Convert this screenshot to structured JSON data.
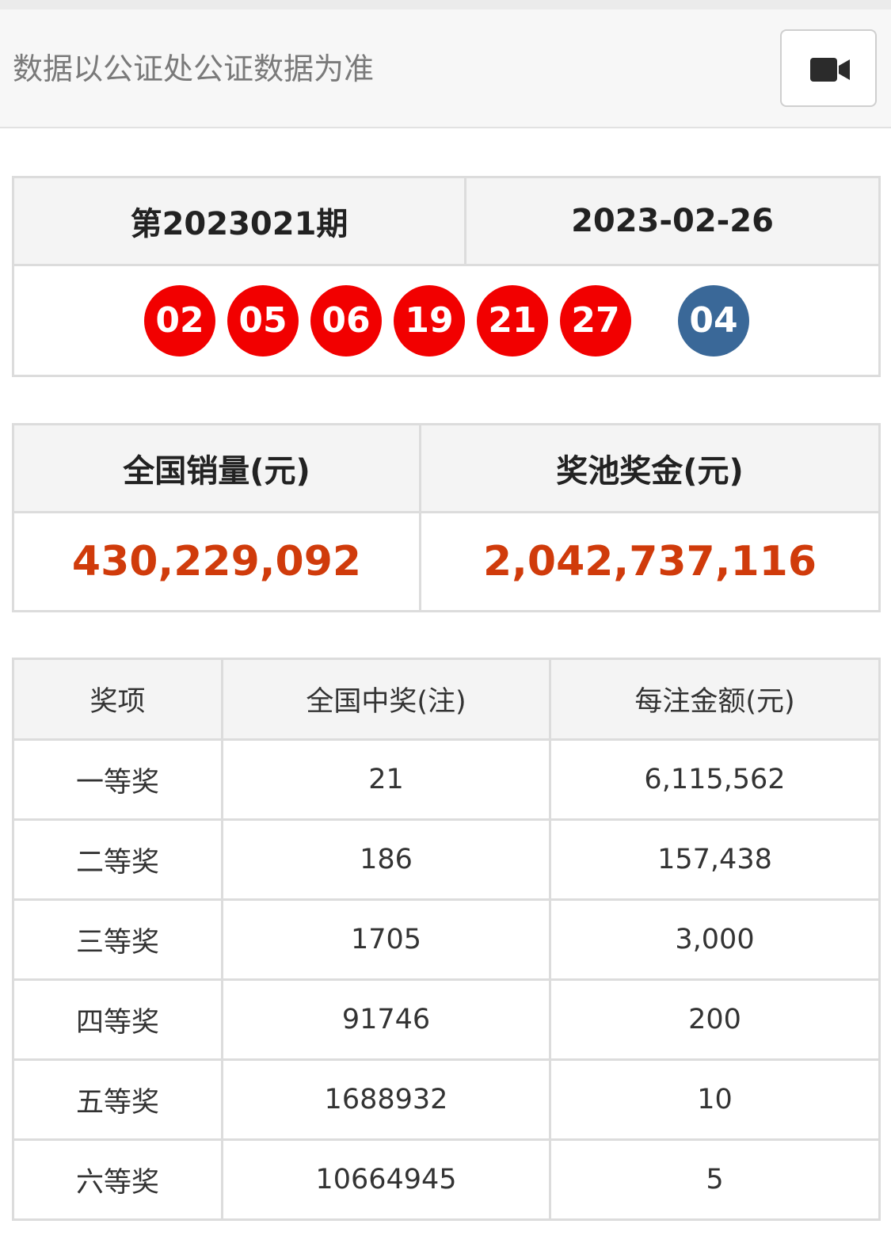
{
  "header": {
    "note": "数据以公证处公证数据为准",
    "video_icon": "video-camera-icon"
  },
  "draw": {
    "issue": "第2023021期",
    "date": "2023-02-26",
    "red_balls": [
      "02",
      "05",
      "06",
      "19",
      "21",
      "27"
    ],
    "blue_ball": "04",
    "colors": {
      "red_ball": "#f20000",
      "blue_ball": "#3a6898"
    }
  },
  "sales": {
    "sales_label": "全国销量(元)",
    "pool_label": "奖池奖金(元)",
    "sales_value": "430,229,092",
    "pool_value": "2,042,737,116",
    "value_color": "#d03b0b"
  },
  "prizes": {
    "headers": [
      "奖项",
      "全国中奖(注)",
      "每注金额(元)"
    ],
    "rows": [
      {
        "level": "一等奖",
        "winners": "21",
        "amount": "6,115,562"
      },
      {
        "level": "二等奖",
        "winners": "186",
        "amount": "157,438"
      },
      {
        "level": "三等奖",
        "winners": "1705",
        "amount": "3,000"
      },
      {
        "level": "四等奖",
        "winners": "91746",
        "amount": "200"
      },
      {
        "level": "五等奖",
        "winners": "1688932",
        "amount": "10"
      },
      {
        "level": "六等奖",
        "winners": "10664945",
        "amount": "5"
      }
    ]
  }
}
